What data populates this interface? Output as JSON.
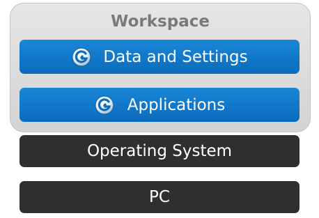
{
  "workspace": {
    "title": "Workspace"
  },
  "layers": {
    "data_settings": {
      "label": "Data and Settings",
      "icon": "swirl-logo-icon"
    },
    "applications": {
      "label": "Applications",
      "icon": "swirl-logo-icon"
    },
    "operating_system": {
      "label": "Operating System"
    },
    "pc": {
      "label": "PC"
    }
  },
  "colors": {
    "workspace_bg": "#d9d9d9",
    "workspace_title": "#7a7a7a",
    "blue_bar": "#0f77c8",
    "dark_bar": "#2f2f2f",
    "bar_text": "#ffffff"
  }
}
